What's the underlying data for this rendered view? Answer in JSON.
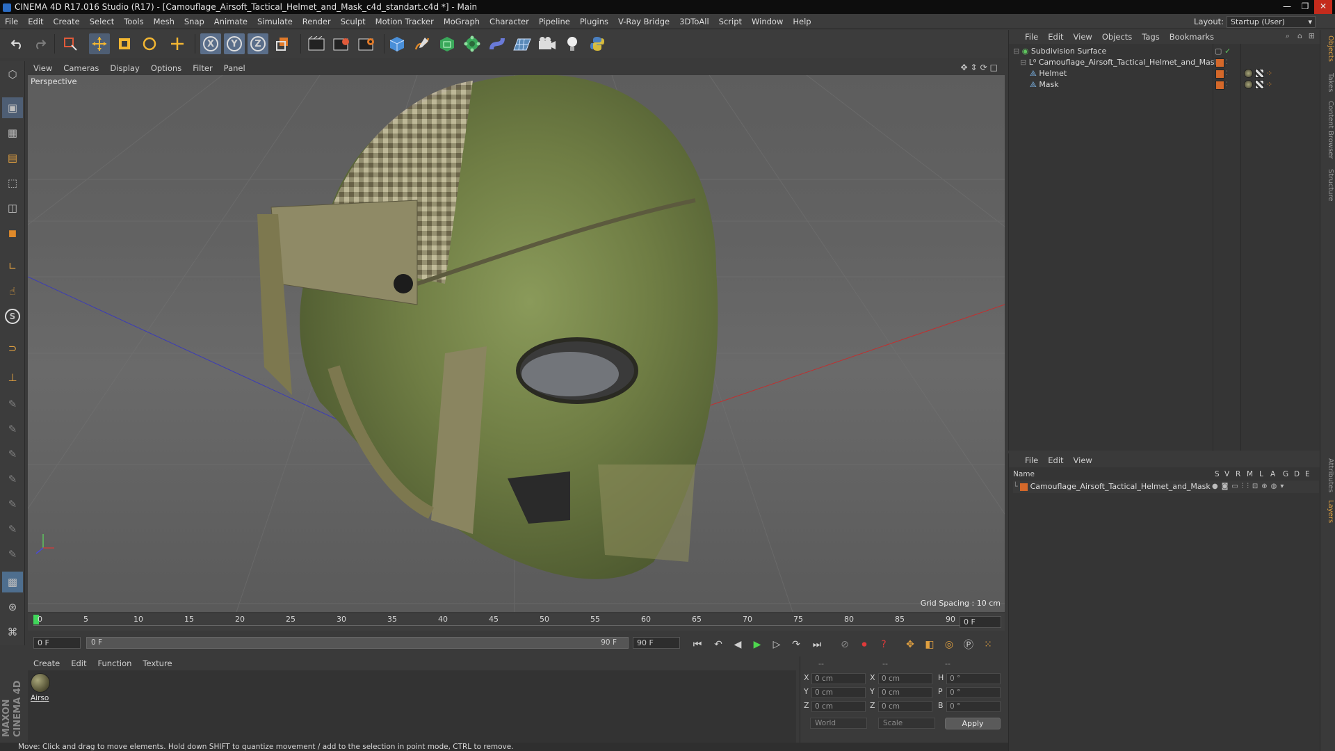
{
  "window": {
    "title": "CINEMA 4D R17.016 Studio (R17) - [Camouflage_Airsoft_Tactical_Helmet_and_Mask_c4d_standart.c4d *] - Main",
    "controls": [
      "—",
      "❐",
      "✕"
    ]
  },
  "menubar": {
    "items": [
      "File",
      "Edit",
      "Create",
      "Select",
      "Tools",
      "Mesh",
      "Snap",
      "Animate",
      "Simulate",
      "Render",
      "Sculpt",
      "Motion Tracker",
      "MoGraph",
      "Character",
      "Pipeline",
      "Plugins",
      "V-Ray Bridge",
      "3DToAll",
      "Script",
      "Window",
      "Help"
    ],
    "layout_label": "Layout:",
    "layout_value": "Startup (User)"
  },
  "toolbar": {
    "icons": [
      "undo-icon",
      "redo-icon",
      "live-selection-icon",
      "move-icon",
      "scale-icon",
      "rotate-icon",
      "recent-tools-icon",
      "x-axis-icon",
      "y-axis-icon",
      "z-axis-icon",
      "coordinate-system-icon",
      "render-view-icon",
      "render-picture-viewer-icon",
      "render-settings-icon",
      "cube-primitive-icon",
      "spline-pen-icon",
      "subdivision-icon",
      "cloner-icon",
      "deformer-icon",
      "floor-icon",
      "camera-icon",
      "light-icon",
      "python-icon"
    ],
    "axis_x": "X",
    "axis_y": "Y",
    "axis_z": "Z"
  },
  "viewport": {
    "menu": [
      "View",
      "Cameras",
      "Display",
      "Options",
      "Filter",
      "Panel"
    ],
    "label": "Perspective",
    "grid_spacing": "Grid Spacing : 10 cm"
  },
  "timeline": {
    "ticks": [
      "0",
      "5",
      "10",
      "15",
      "20",
      "25",
      "30",
      "35",
      "40",
      "45",
      "50",
      "55",
      "60",
      "65",
      "70",
      "75",
      "80",
      "85",
      "90"
    ],
    "current_frame": "0 F",
    "start_field": "0 F",
    "range_start": "0 F",
    "range_end": "90 F",
    "end_field": "90 F"
  },
  "material_manager": {
    "menu": [
      "Create",
      "Edit",
      "Function",
      "Texture"
    ],
    "materials": [
      {
        "name": "Airso"
      }
    ]
  },
  "coordinates": {
    "headers": [
      "--",
      "--",
      "--"
    ],
    "rows": [
      {
        "pos_label": "X",
        "pos": "0 cm",
        "size_label": "X",
        "size": "0 cm",
        "rot_label": "H",
        "rot": "0 °"
      },
      {
        "pos_label": "Y",
        "pos": "0 cm",
        "size_label": "Y",
        "size": "0 cm",
        "rot_label": "P",
        "rot": "0 °"
      },
      {
        "pos_label": "Z",
        "pos": "0 cm",
        "size_label": "Z",
        "size": "0 cm",
        "rot_label": "B",
        "rot": "0 °"
      }
    ],
    "mode": "World",
    "transform": "Scale",
    "apply": "Apply"
  },
  "object_manager": {
    "menu": [
      "File",
      "Edit",
      "View",
      "Objects",
      "Tags",
      "Bookmarks"
    ],
    "objects": [
      {
        "name": "Subdivision Surface"
      },
      {
        "name": "Camouflage_Airsoft_Tactical_Helmet_and_Mask"
      },
      {
        "name": "Helmet"
      },
      {
        "name": "Mask"
      }
    ]
  },
  "layer_manager": {
    "menu": [
      "File",
      "Edit",
      "View"
    ],
    "columns": [
      "Name",
      "S",
      "V",
      "R",
      "M",
      "L",
      "A",
      "G",
      "D",
      "E"
    ],
    "layers": [
      {
        "name": "Camouflage_Airsoft_Tactical_Helmet_and_Mask",
        "color": "#d4682a"
      }
    ]
  },
  "right_tabs": [
    "Objects",
    "Takes",
    "Content Browser",
    "Structure",
    "Attributes",
    "Layers"
  ],
  "status": "Move: Click and drag to move elements. Hold down SHIFT to quantize movement / add to the selection in point mode, CTRL to remove.",
  "brand": "MAXON CINEMA 4D",
  "colors": {
    "accent_orange": "#d4682a",
    "green_ok": "#5ec45e",
    "viewport_bg": "#636363"
  }
}
